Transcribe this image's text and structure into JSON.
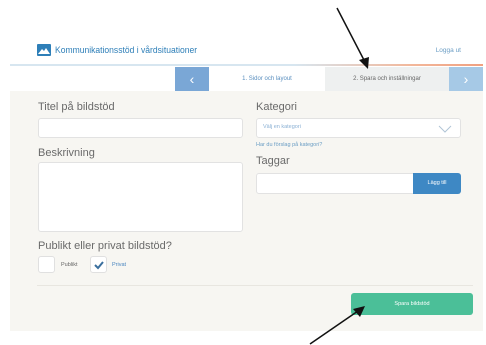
{
  "header": {
    "brand": "Kommunikationsstöd i vårdsituationer",
    "logout": "Logga ut"
  },
  "steps": {
    "step1": "1. Sidor och layout",
    "step2": "2. Spara och inställningar",
    "prev_glyph": "‹",
    "next_glyph": "›"
  },
  "form": {
    "title_label": "Titel på bildstöd",
    "title_value": "",
    "description_label": "Beskrivning",
    "description_value": "",
    "category_label": "Kategori",
    "category_select": "Välj en kategori",
    "category_hint": "Har du förslag på kategori?",
    "tags_label": "Taggar",
    "tags_value": "",
    "add_tag": "Lägg till",
    "visibility_label": "Publikt eller privat bildstöd?",
    "public_label": "Publikt",
    "private_label": "Privat",
    "private_checked": true,
    "save": "Spara bildstöd"
  },
  "colors": {
    "brand": "#2e7fb8",
    "step_nav": "#7aa7d6",
    "add_button": "#3e88c4",
    "save_button": "#4bbf98"
  }
}
